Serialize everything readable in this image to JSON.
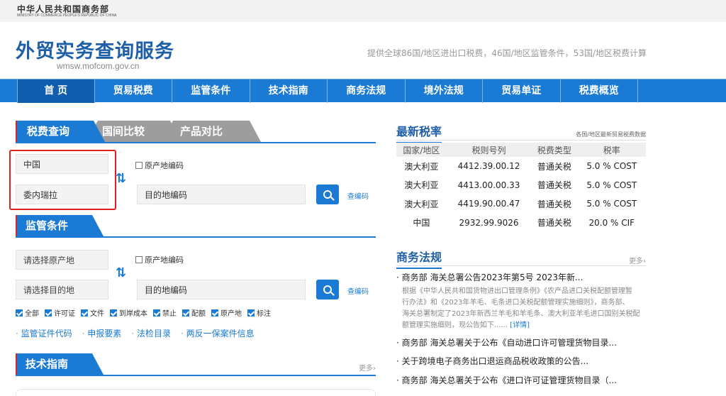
{
  "header": {
    "ministry_cn": "中华人民共和国商务部",
    "ministry_en": "MINISTRY OF COMMERCE PEOPLE'S REPUBLIC OF CHINA",
    "site_title": "外贸实务查询服务",
    "site_url": "wmsw.mofcom.gov.cn",
    "tagline": "提供全球86国/地区进出口税费，46国/地区监管条件，53国/地区税费计算"
  },
  "nav": [
    "首 页",
    "贸易税费",
    "监管条件",
    "技术指南",
    "商务法规",
    "境外法规",
    "贸易单证",
    "税费概览"
  ],
  "tax_query": {
    "tabs": [
      "税费查询",
      "国间比较",
      "产品对比"
    ],
    "origin_value": "中国",
    "dest_value": "委内瑞拉",
    "origin_code_label": "原产地编码",
    "dest_code_placeholder": "目的地编码",
    "lookup_link": "查编码"
  },
  "regulation": {
    "title": "监管条件",
    "origin_placeholder": "请选择原产地",
    "dest_placeholder": "请选择目的地",
    "origin_code_label": "原产地编码",
    "dest_code_placeholder": "目的地编码",
    "lookup_link": "查编码",
    "checks": [
      "全部",
      "许可证",
      "文件",
      "到岸成本",
      "禁止",
      "配额",
      "原产地",
      "标注"
    ],
    "links": [
      "监管证件代码",
      "申报要素",
      "法检目录",
      "两反一保案件信息"
    ]
  },
  "tech_guide": {
    "title": "技术指南",
    "more": "更多›"
  },
  "latest_rates": {
    "title": "最新税率",
    "subtitle": "各国/地区最新贸易税费数据",
    "columns": [
      "国家/地区",
      "税则号列",
      "税费类型",
      "税率"
    ],
    "rows": [
      [
        "澳大利亚",
        "4412.39.00.12",
        "普通关税",
        "5.0 % COST"
      ],
      [
        "澳大利亚",
        "4413.00.00.33",
        "普通关税",
        "5.0 % COST"
      ],
      [
        "澳大利亚",
        "4419.90.00.47",
        "普通关税",
        "5.0 % COST"
      ],
      [
        "中国",
        "2932.99.9026",
        "普通关税",
        "20.0 % CIF"
      ]
    ]
  },
  "commerce_law": {
    "title": "商务法规",
    "more": "更多›",
    "items": [
      "· 商务部 海关总署公告2023年第5号 2023年新...",
      "· 商务部 海关总署关于公布《自动进口许可管理货物目录...",
      "· 关于跨境电子商务出口退运商品税收政策的公告...",
      "· 商务部 海关总署关于公布《进口许可证管理货物目录（..."
    ],
    "desc_lines": [
      "根据《中华人民共和国货物进出口管理条例》《农产品进口关税配额管理暂",
      "行办法》和《2023年羊毛、毛条进口关税配额管理实施细则》，商务部、",
      "海关总署制定了2023年新西兰羊毛和羊毛条、澳大利亚羊毛进口国别关税配",
      "额管理实施细则，现公告如下......"
    ],
    "detail_link": "[详情]"
  }
}
